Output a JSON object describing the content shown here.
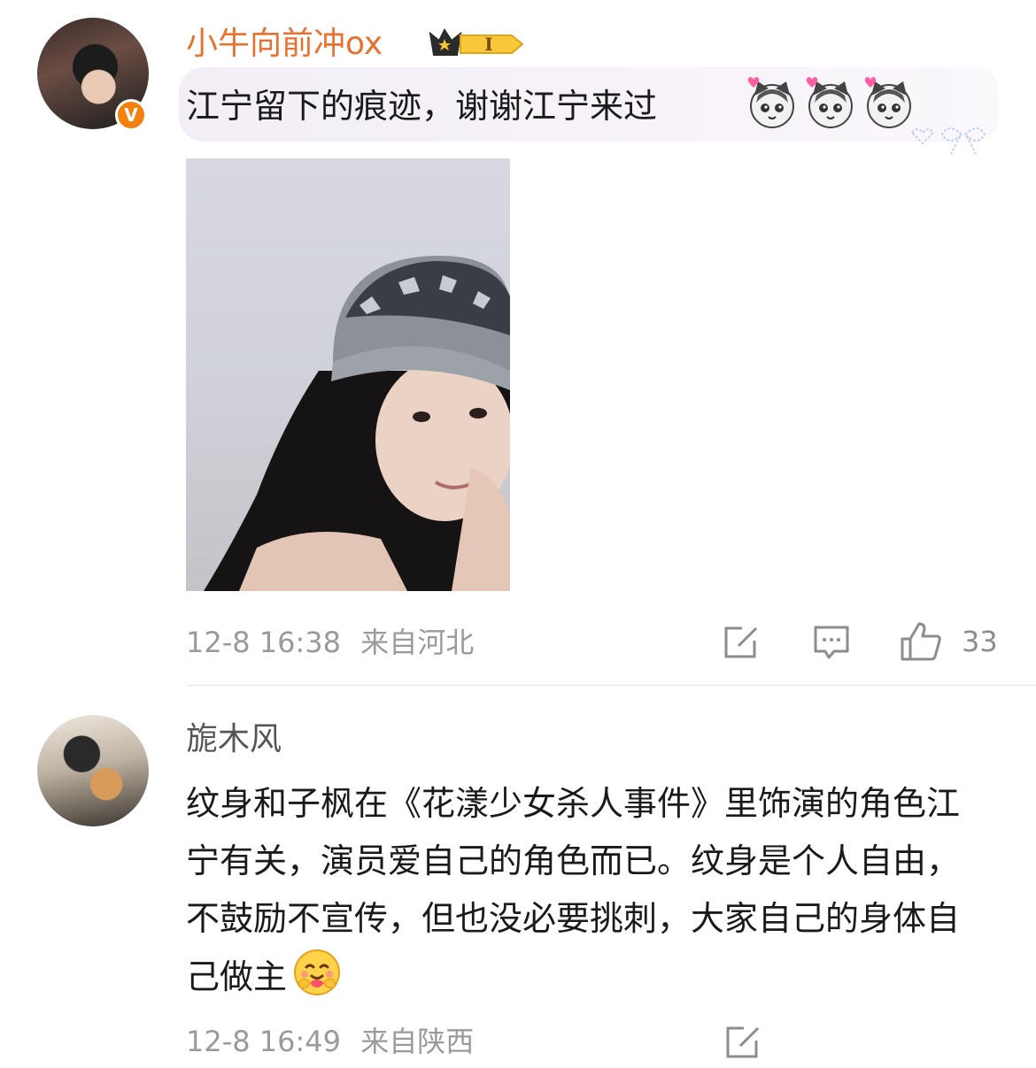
{
  "comments": [
    {
      "username": "小牛向前冲ox",
      "verified_badge": "V",
      "badge_icon": "crown-level-badge",
      "badge_level": "I",
      "text": "江宁留下的痕迹，谢谢江宁来过",
      "emojis": [
        "heart-cat-emoji",
        "heart-cat-emoji",
        "heart-cat-emoji"
      ],
      "image": "photo-girl-beanie",
      "timestamp": "12-8 16:38",
      "location": "来自河北",
      "actions": {
        "repost_icon": "repost-icon",
        "comment_icon": "comment-icon",
        "like_icon": "thumbs-up-icon",
        "like_count": "33"
      }
    },
    {
      "username": "旎木风",
      "text": "纹身和子枫在《花漾少女杀人事件》里饰演的角色江宁有关，演员爱自己的角色而已。纹身是个人自由，不鼓励不宣传，但也没必要挑刺，大家自己的身体自己做主",
      "emoji": "hugging-face-emoji",
      "timestamp": "12-8 16:49",
      "location": "来自陕西",
      "actions": {
        "repost_icon": "repost-icon"
      }
    }
  ],
  "colors": {
    "username_vip": "#e8712f",
    "username_normal": "#555555",
    "meta": "#9a9a9a",
    "verified": "#f4810e"
  }
}
